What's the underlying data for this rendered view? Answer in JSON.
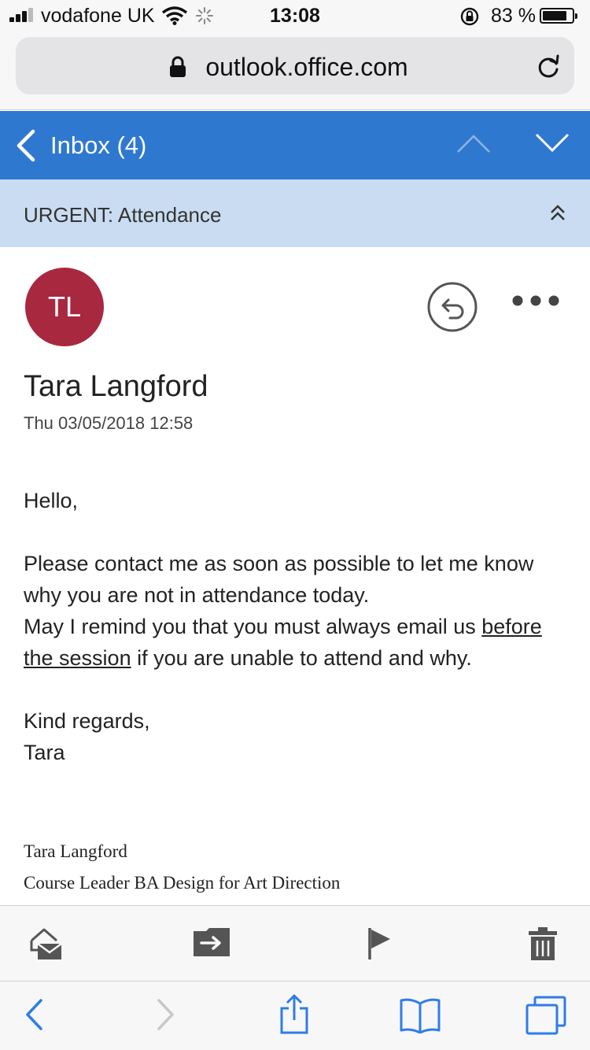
{
  "status_bar": {
    "carrier": "vodafone UK",
    "time": "13:08",
    "battery_percent": "83 %",
    "battery_level": 0.83
  },
  "browser": {
    "url": "outlook.office.com"
  },
  "outlook_header": {
    "inbox_label": "Inbox (4)",
    "accent_color": "#2f78d0"
  },
  "subject": {
    "text": "URGENT: Attendance"
  },
  "message": {
    "avatar_initials": "TL",
    "avatar_color": "#a8283f",
    "sender": "Tara Langford",
    "date": "Thu 03/05/2018 12:58",
    "greeting": "Hello,",
    "line1": "Please contact me as soon as possible to let me know why you are not in attendance today.",
    "line2_start": "May I remind you that you must always email us ",
    "line2_underlined": "before the session",
    "line2_end": " if you are unable to attend and why.",
    "closing": "Kind regards,",
    "closing_name": "Tara",
    "signature_name": "Tara Langford",
    "signature_title": "Course Leader BA Design for Art Direction"
  },
  "icons": {
    "action_bar": [
      "mark-read-icon",
      "move-icon",
      "flag-icon",
      "trash-icon"
    ],
    "safari_bar": [
      "back-icon",
      "forward-icon",
      "share-icon",
      "bookmarks-icon",
      "tabs-icon"
    ]
  }
}
